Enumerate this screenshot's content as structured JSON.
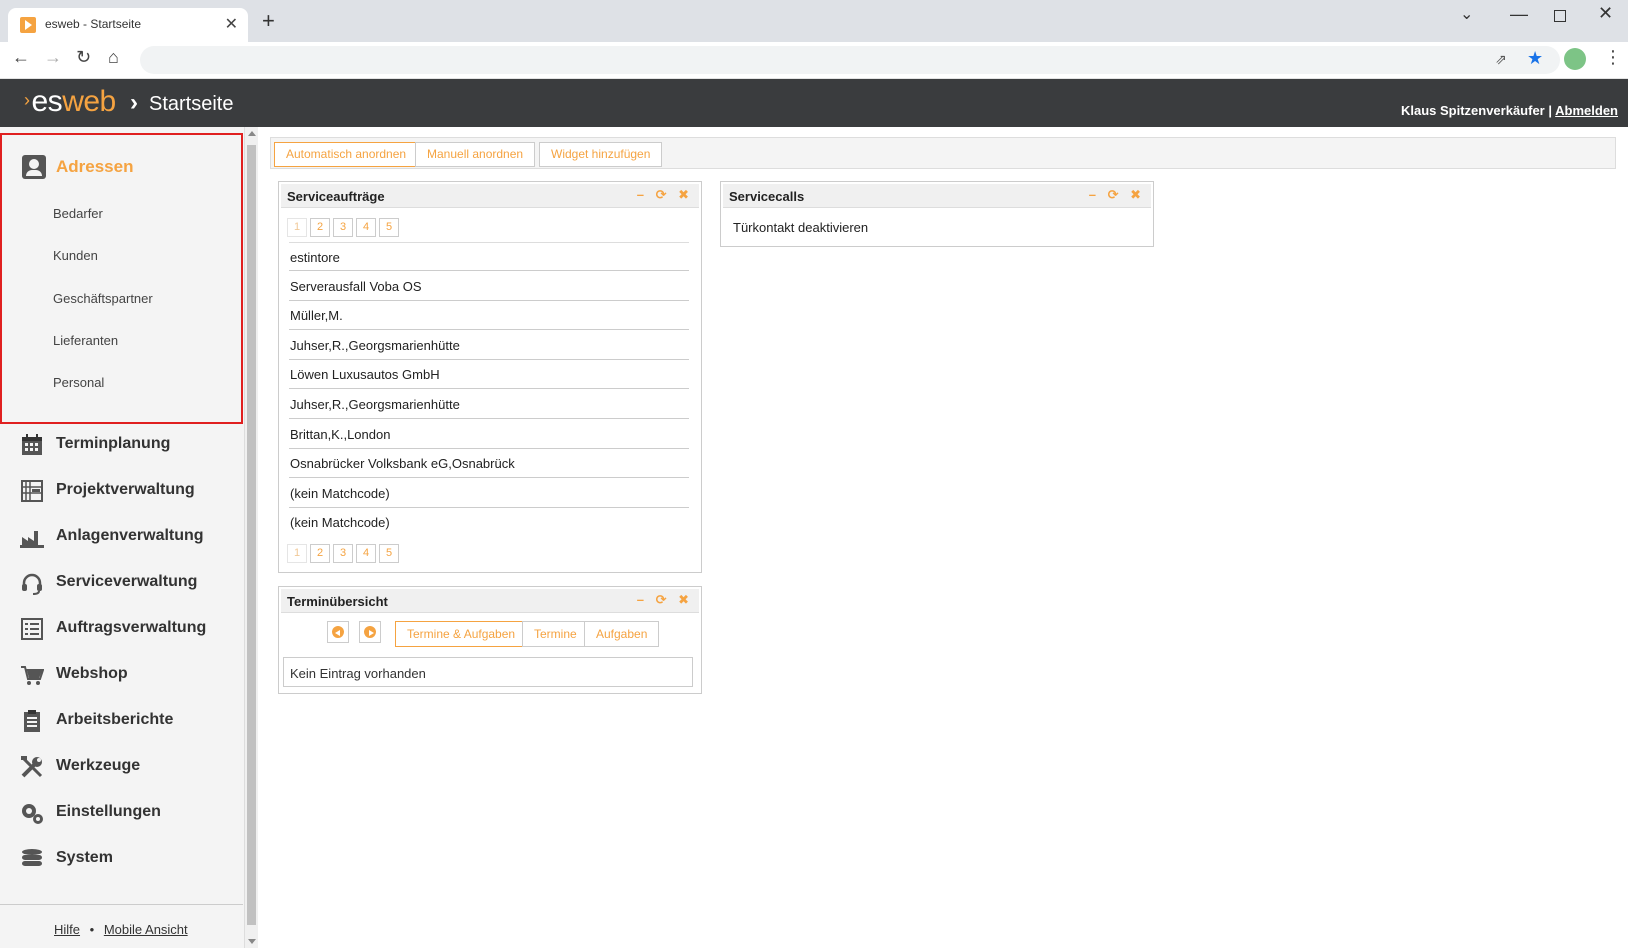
{
  "browser": {
    "tab_title": "esweb - Startseite",
    "tab_close": "✕",
    "new_tab": "+",
    "window_controls": {
      "dropdown": "⌄",
      "minimize": "—",
      "close": "✕"
    }
  },
  "header": {
    "logo_prefix": "es",
    "logo_suffix": "web",
    "separator": "›",
    "page_title": "Startseite",
    "user_name": "Klaus Spitzenverkäufer",
    "user_sep": "|",
    "logout_label": "Abmelden"
  },
  "sidebar": {
    "adressen": {
      "label": "Adressen",
      "items": [
        "Bedarfer",
        "Kunden",
        "Geschäftspartner",
        "Lieferanten",
        "Personal"
      ]
    },
    "items": [
      {
        "label": "Terminplanung",
        "icon": "calendar-icon"
      },
      {
        "label": "Projektverwaltung",
        "icon": "project-icon"
      },
      {
        "label": "Anlagenverwaltung",
        "icon": "factory-icon"
      },
      {
        "label": "Serviceverwaltung",
        "icon": "headset-icon"
      },
      {
        "label": "Auftragsverwaltung",
        "icon": "list-icon"
      },
      {
        "label": "Webshop",
        "icon": "cart-icon"
      },
      {
        "label": "Arbeitsberichte",
        "icon": "clipboard-icon"
      },
      {
        "label": "Werkzeuge",
        "icon": "tools-icon"
      },
      {
        "label": "Einstellungen",
        "icon": "gears-icon"
      },
      {
        "label": "System",
        "icon": "database-icon"
      }
    ],
    "footer": {
      "help": "Hilfe",
      "dot": "•",
      "mobile": "Mobile Ansicht"
    }
  },
  "toolbar": {
    "auto_arrange": "Automatisch anordnen",
    "manual_arrange": "Manuell anordnen",
    "add_widget": "Widget hinzufügen"
  },
  "widgets": {
    "controls": "– ⟳ ✖",
    "serviceauftraege": {
      "title": "Serviceaufträge",
      "pages": [
        "1",
        "2",
        "3",
        "4",
        "5"
      ],
      "rows": [
        "estintore",
        "Serverausfall Voba OS",
        "Müller,M.",
        "Juhser,R.,Georgsmarienhütte",
        "Löwen Luxusautos GmbH",
        "Juhser,R.,Georgsmarienhütte",
        "Brittan,K.,London",
        "Osnabrücker Volksbank eG,Osnabrück",
        "(kein Matchcode)",
        "(kein Matchcode)"
      ]
    },
    "servicecalls": {
      "title": "Servicecalls",
      "text": "Türkontakt deaktivieren"
    },
    "terminuebersicht": {
      "title": "Terminübersicht",
      "segments": [
        "Termine & Aufgaben",
        "Termine",
        "Aufgaben"
      ],
      "empty": "Kein Eintrag vorhanden"
    }
  },
  "colors": {
    "accent": "#f5a341",
    "header_bg": "#3a3c3e",
    "highlight_border": "#e02020"
  }
}
